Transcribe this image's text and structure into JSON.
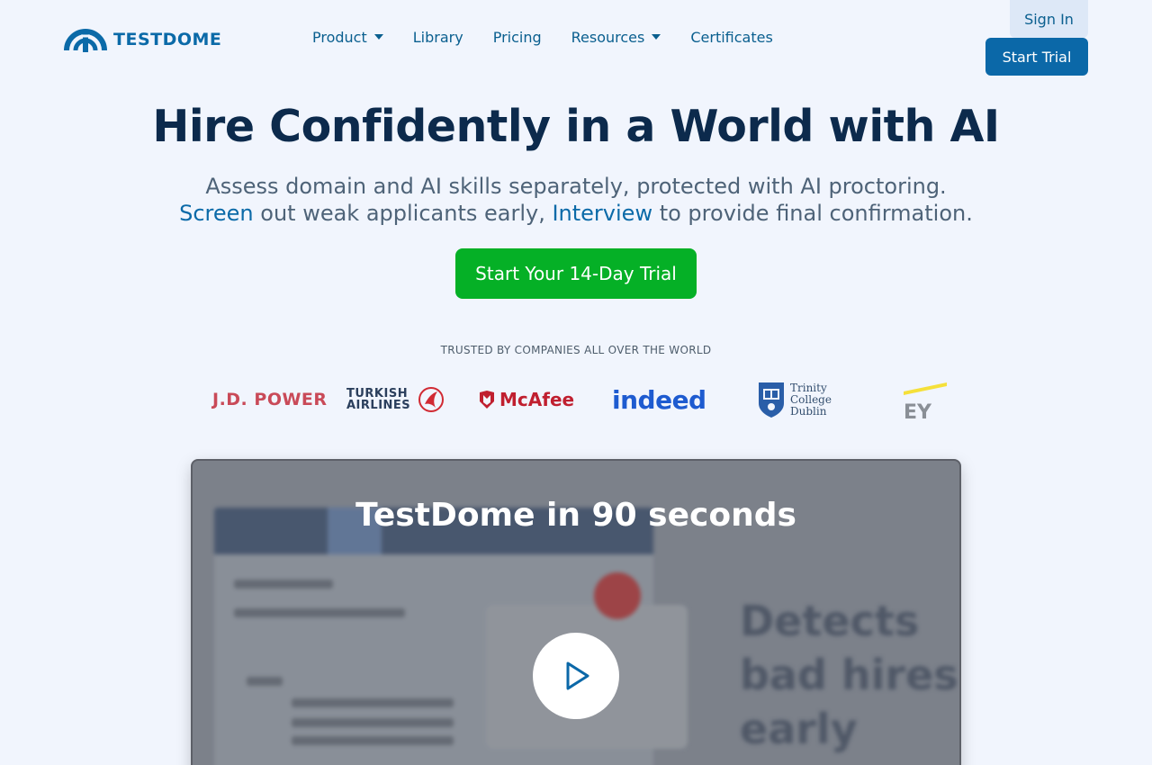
{
  "header": {
    "logo_text": "TESTDOME",
    "nav": [
      {
        "label": "Product",
        "has_dropdown": true
      },
      {
        "label": "Library",
        "has_dropdown": false
      },
      {
        "label": "Pricing",
        "has_dropdown": false
      },
      {
        "label": "Resources",
        "has_dropdown": true
      },
      {
        "label": "Certificates",
        "has_dropdown": false
      }
    ],
    "sign_in_label": "Sign In",
    "start_trial_label": "Start Trial"
  },
  "hero": {
    "title": "Hire Confidently in a World with AI",
    "subtitle_line1": "Assess domain and AI skills separately, protected with AI proctoring.",
    "subtitle_line2_word1": "Screen",
    "subtitle_line2_mid": " out weak applicants early, ",
    "subtitle_line2_word2": "Interview",
    "subtitle_line2_end": " to provide final confirmation.",
    "cta_label": "Start Your 14-Day Trial"
  },
  "trusted": {
    "heading": "TRUSTED BY COMPANIES ALL OVER THE WORLD",
    "companies": [
      {
        "name": "J.D. POWER"
      },
      {
        "name_line1": "TURKISH",
        "name_line2": "AIRLINES"
      },
      {
        "name": "McAfee"
      },
      {
        "name": "indeed"
      },
      {
        "name_line1": "Trinity",
        "name_line2": "College",
        "name_line3": "Dublin"
      },
      {
        "name": "EY"
      }
    ]
  },
  "video": {
    "title": "TestDome in 90 seconds",
    "background_text": [
      "Detects",
      "bad hires",
      "early"
    ]
  },
  "colors": {
    "brand_blue": "#0b68a8",
    "cta_green": "#05b026",
    "page_bg": "#f1f5fd",
    "title_navy": "#0c2a4c"
  }
}
